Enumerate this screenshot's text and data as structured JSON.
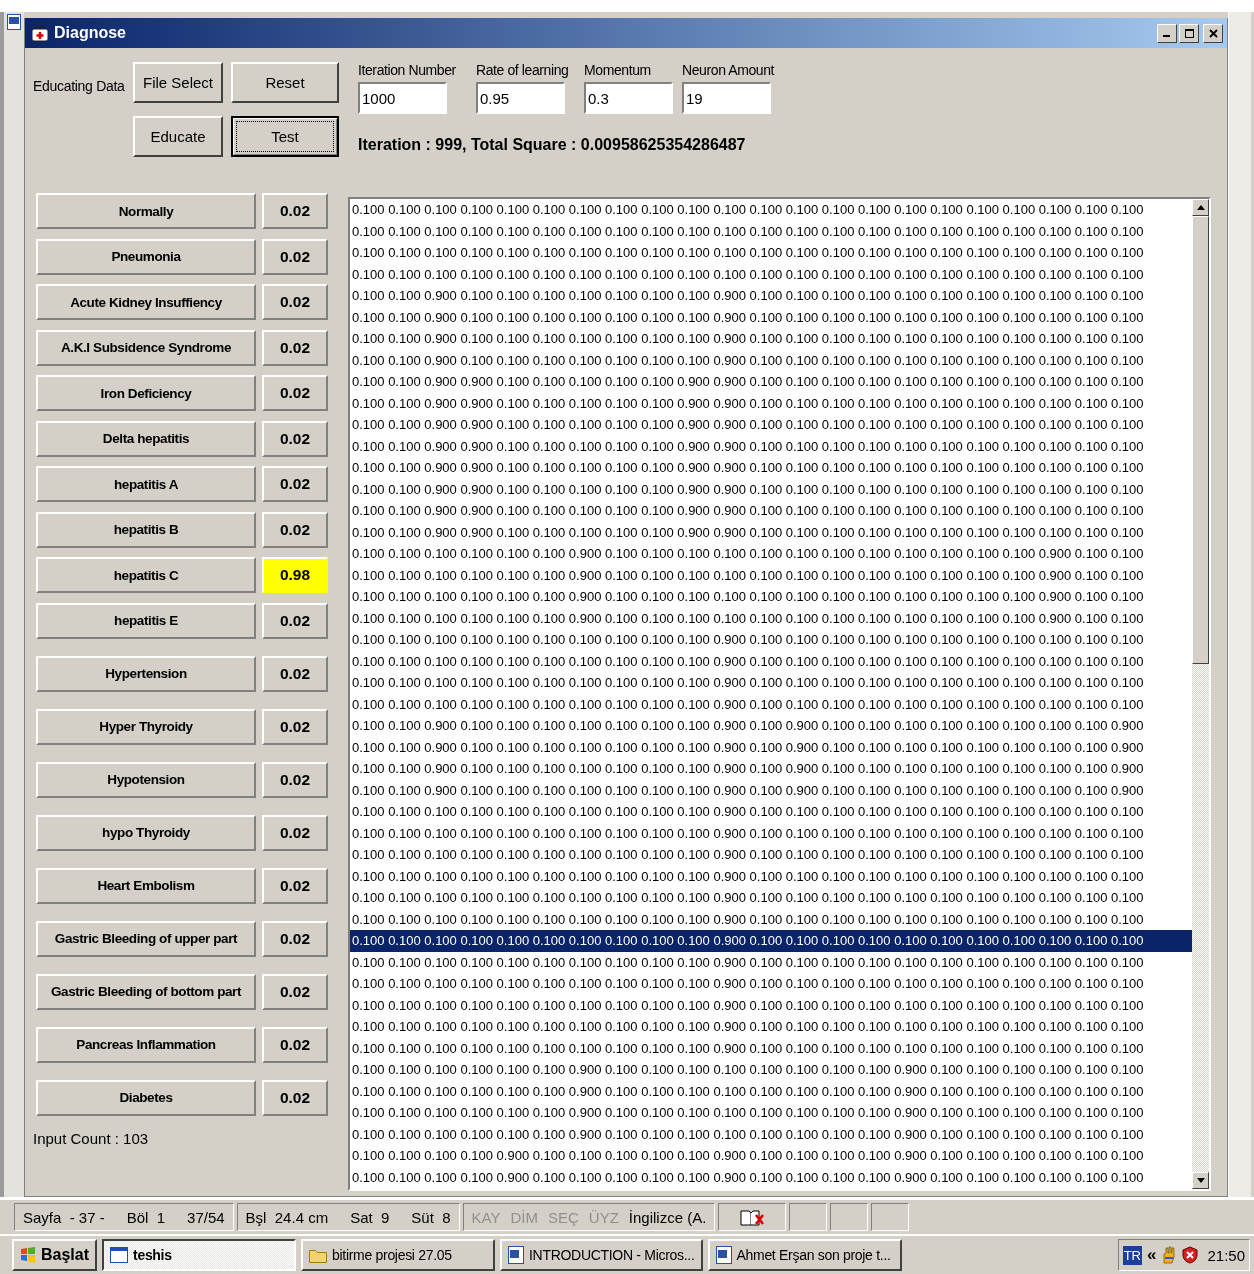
{
  "window": {
    "title": "Diagnose"
  },
  "educating_data": {
    "label": "Educating Data"
  },
  "buttons": [
    {
      "label": "File Select",
      "focused": false
    },
    {
      "label": "Reset",
      "focused": false
    },
    {
      "label": "Educate",
      "focused": false
    },
    {
      "label": "Test",
      "focused": true
    }
  ],
  "fields": [
    {
      "label": "Iteration Number",
      "value": "1000"
    },
    {
      "label": "Rate of learning",
      "value": "0.95"
    },
    {
      "label": "Momentum",
      "value": "0.3"
    },
    {
      "label": "Neuron Amount",
      "value": "19"
    }
  ],
  "result_text": "Iteration : 999, Total Square : 0.00958625354286487",
  "diagnoses": [
    {
      "name": "Normally",
      "value": "0.02",
      "highlighted": false
    },
    {
      "name": "Pneumonia",
      "value": "0.02",
      "highlighted": false
    },
    {
      "name": "Acute Kidney Insuffiency",
      "value": "0.02",
      "highlighted": false
    },
    {
      "name": "A.K.I Subsidence Syndrome",
      "value": "0.02",
      "highlighted": false
    },
    {
      "name": "Iron Deficiency",
      "value": "0.02",
      "highlighted": false
    },
    {
      "name": "Delta hepatitis",
      "value": "0.02",
      "highlighted": false
    },
    {
      "name": "hepatitis A",
      "value": "0.02",
      "highlighted": false
    },
    {
      "name": "hepatitis B",
      "value": "0.02",
      "highlighted": false
    },
    {
      "name": "hepatitis C",
      "value": "0.98",
      "highlighted": true
    },
    {
      "name": "hepatitis E",
      "value": "0.02",
      "highlighted": false
    },
    {
      "name": "Hypertension",
      "value": "0.02",
      "highlighted": false
    },
    {
      "name": "Hyper Thyroidy",
      "value": "0.02",
      "highlighted": false
    },
    {
      "name": "Hypotension",
      "value": "0.02",
      "highlighted": false
    },
    {
      "name": "hypo Thyroidy",
      "value": "0.02",
      "highlighted": false
    },
    {
      "name": "Heart Embolism",
      "value": "0.02",
      "highlighted": false
    },
    {
      "name": "Gastric Bleeding of upper part",
      "value": "0.02",
      "highlighted": false
    },
    {
      "name": "Gastric Bleeding of bottom part",
      "value": "0.02",
      "highlighted": false
    },
    {
      "name": "Pancreas Inflammation",
      "value": "0.02",
      "highlighted": false
    },
    {
      "name": "Diabetes",
      "value": "0.02",
      "highlighted": false
    }
  ],
  "input_count": "Input Count : 103",
  "data_rows": [
    {
      "text": "0.100 0.100 0.100 0.100 0.100 0.100 0.100 0.100 0.100 0.100 0.100 0.100 0.100 0.100 0.100 0.100 0.100 0.100 0.100 0.100 0.100 0.100",
      "selected": false
    },
    {
      "text": "0.100 0.100 0.100 0.100 0.100 0.100 0.100 0.100 0.100 0.100 0.100 0.100 0.100 0.100 0.100 0.100 0.100 0.100 0.100 0.100 0.100 0.100",
      "selected": false
    },
    {
      "text": "0.100 0.100 0.100 0.100 0.100 0.100 0.100 0.100 0.100 0.100 0.100 0.100 0.100 0.100 0.100 0.100 0.100 0.100 0.100 0.100 0.100 0.100",
      "selected": false
    },
    {
      "text": "0.100 0.100 0.100 0.100 0.100 0.100 0.100 0.100 0.100 0.100 0.100 0.100 0.100 0.100 0.100 0.100 0.100 0.100 0.100 0.100 0.100 0.100",
      "selected": false
    },
    {
      "text": "0.100 0.100 0.900 0.100 0.100 0.100 0.100 0.100 0.100 0.100 0.900 0.100 0.100 0.100 0.100 0.100 0.100 0.100 0.100 0.100 0.100 0.100",
      "selected": false
    },
    {
      "text": "0.100 0.100 0.900 0.100 0.100 0.100 0.100 0.100 0.100 0.100 0.900 0.100 0.100 0.100 0.100 0.100 0.100 0.100 0.100 0.100 0.100 0.100",
      "selected": false
    },
    {
      "text": "0.100 0.100 0.900 0.100 0.100 0.100 0.100 0.100 0.100 0.100 0.900 0.100 0.100 0.100 0.100 0.100 0.100 0.100 0.100 0.100 0.100 0.100",
      "selected": false
    },
    {
      "text": "0.100 0.100 0.900 0.100 0.100 0.100 0.100 0.100 0.100 0.100 0.900 0.100 0.100 0.100 0.100 0.100 0.100 0.100 0.100 0.100 0.100 0.100",
      "selected": false
    },
    {
      "text": "0.100 0.100 0.900 0.900 0.100 0.100 0.100 0.100 0.100 0.900 0.900 0.100 0.100 0.100 0.100 0.100 0.100 0.100 0.100 0.100 0.100 0.100",
      "selected": false
    },
    {
      "text": "0.100 0.100 0.900 0.900 0.100 0.100 0.100 0.100 0.100 0.900 0.900 0.100 0.100 0.100 0.100 0.100 0.100 0.100 0.100 0.100 0.100 0.100",
      "selected": false
    },
    {
      "text": "0.100 0.100 0.900 0.900 0.100 0.100 0.100 0.100 0.100 0.900 0.900 0.100 0.100 0.100 0.100 0.100 0.100 0.100 0.100 0.100 0.100 0.100",
      "selected": false
    },
    {
      "text": "0.100 0.100 0.900 0.900 0.100 0.100 0.100 0.100 0.100 0.900 0.900 0.100 0.100 0.100 0.100 0.100 0.100 0.100 0.100 0.100 0.100 0.100",
      "selected": false
    },
    {
      "text": "0.100 0.100 0.900 0.900 0.100 0.100 0.100 0.100 0.100 0.900 0.900 0.100 0.100 0.100 0.100 0.100 0.100 0.100 0.100 0.100 0.100 0.100",
      "selected": false
    },
    {
      "text": "0.100 0.100 0.900 0.900 0.100 0.100 0.100 0.100 0.100 0.900 0.900 0.100 0.100 0.100 0.100 0.100 0.100 0.100 0.100 0.100 0.100 0.100",
      "selected": false
    },
    {
      "text": "0.100 0.100 0.900 0.900 0.100 0.100 0.100 0.100 0.100 0.900 0.900 0.100 0.100 0.100 0.100 0.100 0.100 0.100 0.100 0.100 0.100 0.100",
      "selected": false
    },
    {
      "text": "0.100 0.100 0.900 0.900 0.100 0.100 0.100 0.100 0.100 0.900 0.900 0.100 0.100 0.100 0.100 0.100 0.100 0.100 0.100 0.100 0.100 0.100",
      "selected": false
    },
    {
      "text": "0.100 0.100 0.100 0.100 0.100 0.100 0.900 0.100 0.100 0.100 0.100 0.100 0.100 0.100 0.100 0.100 0.100 0.100 0.100 0.900 0.100 0.100",
      "selected": false
    },
    {
      "text": "0.100 0.100 0.100 0.100 0.100 0.100 0.900 0.100 0.100 0.100 0.100 0.100 0.100 0.100 0.100 0.100 0.100 0.100 0.100 0.900 0.100 0.100",
      "selected": false
    },
    {
      "text": "0.100 0.100 0.100 0.100 0.100 0.100 0.900 0.100 0.100 0.100 0.100 0.100 0.100 0.100 0.100 0.100 0.100 0.100 0.100 0.900 0.100 0.100",
      "selected": false
    },
    {
      "text": "0.100 0.100 0.100 0.100 0.100 0.100 0.900 0.100 0.100 0.100 0.100 0.100 0.100 0.100 0.100 0.100 0.100 0.100 0.100 0.900 0.100 0.100",
      "selected": false
    },
    {
      "text": "0.100 0.100 0.100 0.100 0.100 0.100 0.100 0.100 0.100 0.100 0.900 0.100 0.100 0.100 0.100 0.100 0.100 0.100 0.100 0.100 0.100 0.100",
      "selected": false
    },
    {
      "text": "0.100 0.100 0.100 0.100 0.100 0.100 0.100 0.100 0.100 0.100 0.900 0.100 0.100 0.100 0.100 0.100 0.100 0.100 0.100 0.100 0.100 0.100",
      "selected": false
    },
    {
      "text": "0.100 0.100 0.100 0.100 0.100 0.100 0.100 0.100 0.100 0.100 0.900 0.100 0.100 0.100 0.100 0.100 0.100 0.100 0.100 0.100 0.100 0.100",
      "selected": false
    },
    {
      "text": "0.100 0.100 0.100 0.100 0.100 0.100 0.100 0.100 0.100 0.100 0.900 0.100 0.100 0.100 0.100 0.100 0.100 0.100 0.100 0.100 0.100 0.100",
      "selected": false
    },
    {
      "text": "0.100 0.100 0.900 0.100 0.100 0.100 0.100 0.100 0.100 0.100 0.900 0.100 0.900 0.100 0.100 0.100 0.100 0.100 0.100 0.100 0.100 0.900",
      "selected": false
    },
    {
      "text": "0.100 0.100 0.900 0.100 0.100 0.100 0.100 0.100 0.100 0.100 0.900 0.100 0.900 0.100 0.100 0.100 0.100 0.100 0.100 0.100 0.100 0.900",
      "selected": false
    },
    {
      "text": "0.100 0.100 0.900 0.100 0.100 0.100 0.100 0.100 0.100 0.100 0.900 0.100 0.900 0.100 0.100 0.100 0.100 0.100 0.100 0.100 0.100 0.900",
      "selected": false
    },
    {
      "text": "0.100 0.100 0.900 0.100 0.100 0.100 0.100 0.100 0.100 0.100 0.900 0.100 0.900 0.100 0.100 0.100 0.100 0.100 0.100 0.100 0.100 0.900",
      "selected": false
    },
    {
      "text": "0.100 0.100 0.100 0.100 0.100 0.100 0.100 0.100 0.100 0.100 0.900 0.100 0.100 0.100 0.100 0.100 0.100 0.100 0.100 0.100 0.100 0.100",
      "selected": false
    },
    {
      "text": "0.100 0.100 0.100 0.100 0.100 0.100 0.100 0.100 0.100 0.100 0.900 0.100 0.100 0.100 0.100 0.100 0.100 0.100 0.100 0.100 0.100 0.100",
      "selected": false
    },
    {
      "text": "0.100 0.100 0.100 0.100 0.100 0.100 0.100 0.100 0.100 0.100 0.900 0.100 0.100 0.100 0.100 0.100 0.100 0.100 0.100 0.100 0.100 0.100",
      "selected": false
    },
    {
      "text": "0.100 0.100 0.100 0.100 0.100 0.100 0.100 0.100 0.100 0.100 0.900 0.100 0.100 0.100 0.100 0.100 0.100 0.100 0.100 0.100 0.100 0.100",
      "selected": false
    },
    {
      "text": "0.100 0.100 0.100 0.100 0.100 0.100 0.100 0.100 0.100 0.100 0.900 0.100 0.100 0.100 0.100 0.100 0.100 0.100 0.100 0.100 0.100 0.100",
      "selected": false
    },
    {
      "text": "0.100 0.100 0.100 0.100 0.100 0.100 0.100 0.100 0.100 0.100 0.900 0.100 0.100 0.100 0.100 0.100 0.100 0.100 0.100 0.100 0.100 0.100",
      "selected": false
    },
    {
      "text": "0.100 0.100 0.100 0.100 0.100 0.100 0.100 0.100 0.100 0.100 0.900 0.100 0.100 0.100 0.100 0.100 0.100 0.100 0.100 0.100 0.100 0.100",
      "selected": true
    },
    {
      "text": "0.100 0.100 0.100 0.100 0.100 0.100 0.100 0.100 0.100 0.100 0.900 0.100 0.100 0.100 0.100 0.100 0.100 0.100 0.100 0.100 0.100 0.100",
      "selected": false
    },
    {
      "text": "0.100 0.100 0.100 0.100 0.100 0.100 0.100 0.100 0.100 0.100 0.900 0.100 0.100 0.100 0.100 0.100 0.100 0.100 0.100 0.100 0.100 0.100",
      "selected": false
    },
    {
      "text": "0.100 0.100 0.100 0.100 0.100 0.100 0.100 0.100 0.100 0.100 0.900 0.100 0.100 0.100 0.100 0.100 0.100 0.100 0.100 0.100 0.100 0.100",
      "selected": false
    },
    {
      "text": "0.100 0.100 0.100 0.100 0.100 0.100 0.100 0.100 0.100 0.100 0.900 0.100 0.100 0.100 0.100 0.100 0.100 0.100 0.100 0.100 0.100 0.100",
      "selected": false
    },
    {
      "text": "0.100 0.100 0.100 0.100 0.100 0.100 0.100 0.100 0.100 0.100 0.900 0.100 0.100 0.100 0.100 0.100 0.100 0.100 0.100 0.100 0.100 0.100",
      "selected": false
    },
    {
      "text": "0.100 0.100 0.100 0.100 0.100 0.100 0.900 0.100 0.100 0.100 0.100 0.100 0.100 0.100 0.100 0.900 0.100 0.100 0.100 0.100 0.100 0.100",
      "selected": false
    },
    {
      "text": "0.100 0.100 0.100 0.100 0.100 0.100 0.900 0.100 0.100 0.100 0.100 0.100 0.100 0.100 0.100 0.900 0.100 0.100 0.100 0.100 0.100 0.100",
      "selected": false
    },
    {
      "text": "0.100 0.100 0.100 0.100 0.100 0.100 0.900 0.100 0.100 0.100 0.100 0.100 0.100 0.100 0.100 0.900 0.100 0.100 0.100 0.100 0.100 0.100",
      "selected": false
    },
    {
      "text": "0.100 0.100 0.100 0.100 0.100 0.100 0.900 0.100 0.100 0.100 0.100 0.100 0.100 0.100 0.100 0.900 0.100 0.100 0.100 0.100 0.100 0.100",
      "selected": false
    },
    {
      "text": "0.100 0.100 0.100 0.100 0.900 0.100 0.100 0.100 0.100 0.100 0.900 0.100 0.100 0.100 0.100 0.900 0.100 0.100 0.100 0.100 0.100 0.100",
      "selected": false
    },
    {
      "text": "0.100 0.100 0.100 0.100 0.900 0.100 0.100 0.100 0.100 0.100 0.900 0.100 0.100 0.100 0.100 0.900 0.100 0.100 0.100 0.100 0.100 0.100",
      "selected": false
    }
  ],
  "status_bar": {
    "panes": [
      {
        "items": [
          {
            "text": "Sayfa  - 37 -",
            "disabled": false
          },
          {
            "text": "Böl  1",
            "disabled": false
          },
          {
            "text": "37/54",
            "disabled": false
          }
        ]
      },
      {
        "items": [
          {
            "text": "Bşl  24.4 cm",
            "disabled": false
          },
          {
            "text": "Sat  9",
            "disabled": false
          },
          {
            "text": "Süt  8",
            "disabled": false
          }
        ]
      },
      {
        "items": [
          {
            "text": "KAY",
            "disabled": true
          },
          {
            "text": "DİM",
            "disabled": true
          },
          {
            "text": "SEÇ",
            "disabled": true
          },
          {
            "text": "ÜYZ",
            "disabled": true
          },
          {
            "text": "İngilizce (A.",
            "disabled": false
          }
        ]
      }
    ]
  },
  "taskbar": {
    "start": "Başlat",
    "tasks": [
      {
        "label": "teshis",
        "kind": "window",
        "selected": true
      },
      {
        "label": "bitirme projesi 27.05",
        "kind": "folder",
        "selected": false
      },
      {
        "label": "INTRODUCTION - Micros...",
        "kind": "document",
        "selected": false
      },
      {
        "label": "Ahmet Erşan son proje t...",
        "kind": "document",
        "selected": false
      }
    ],
    "language": "TR",
    "expand": "«",
    "time": "21:50"
  }
}
